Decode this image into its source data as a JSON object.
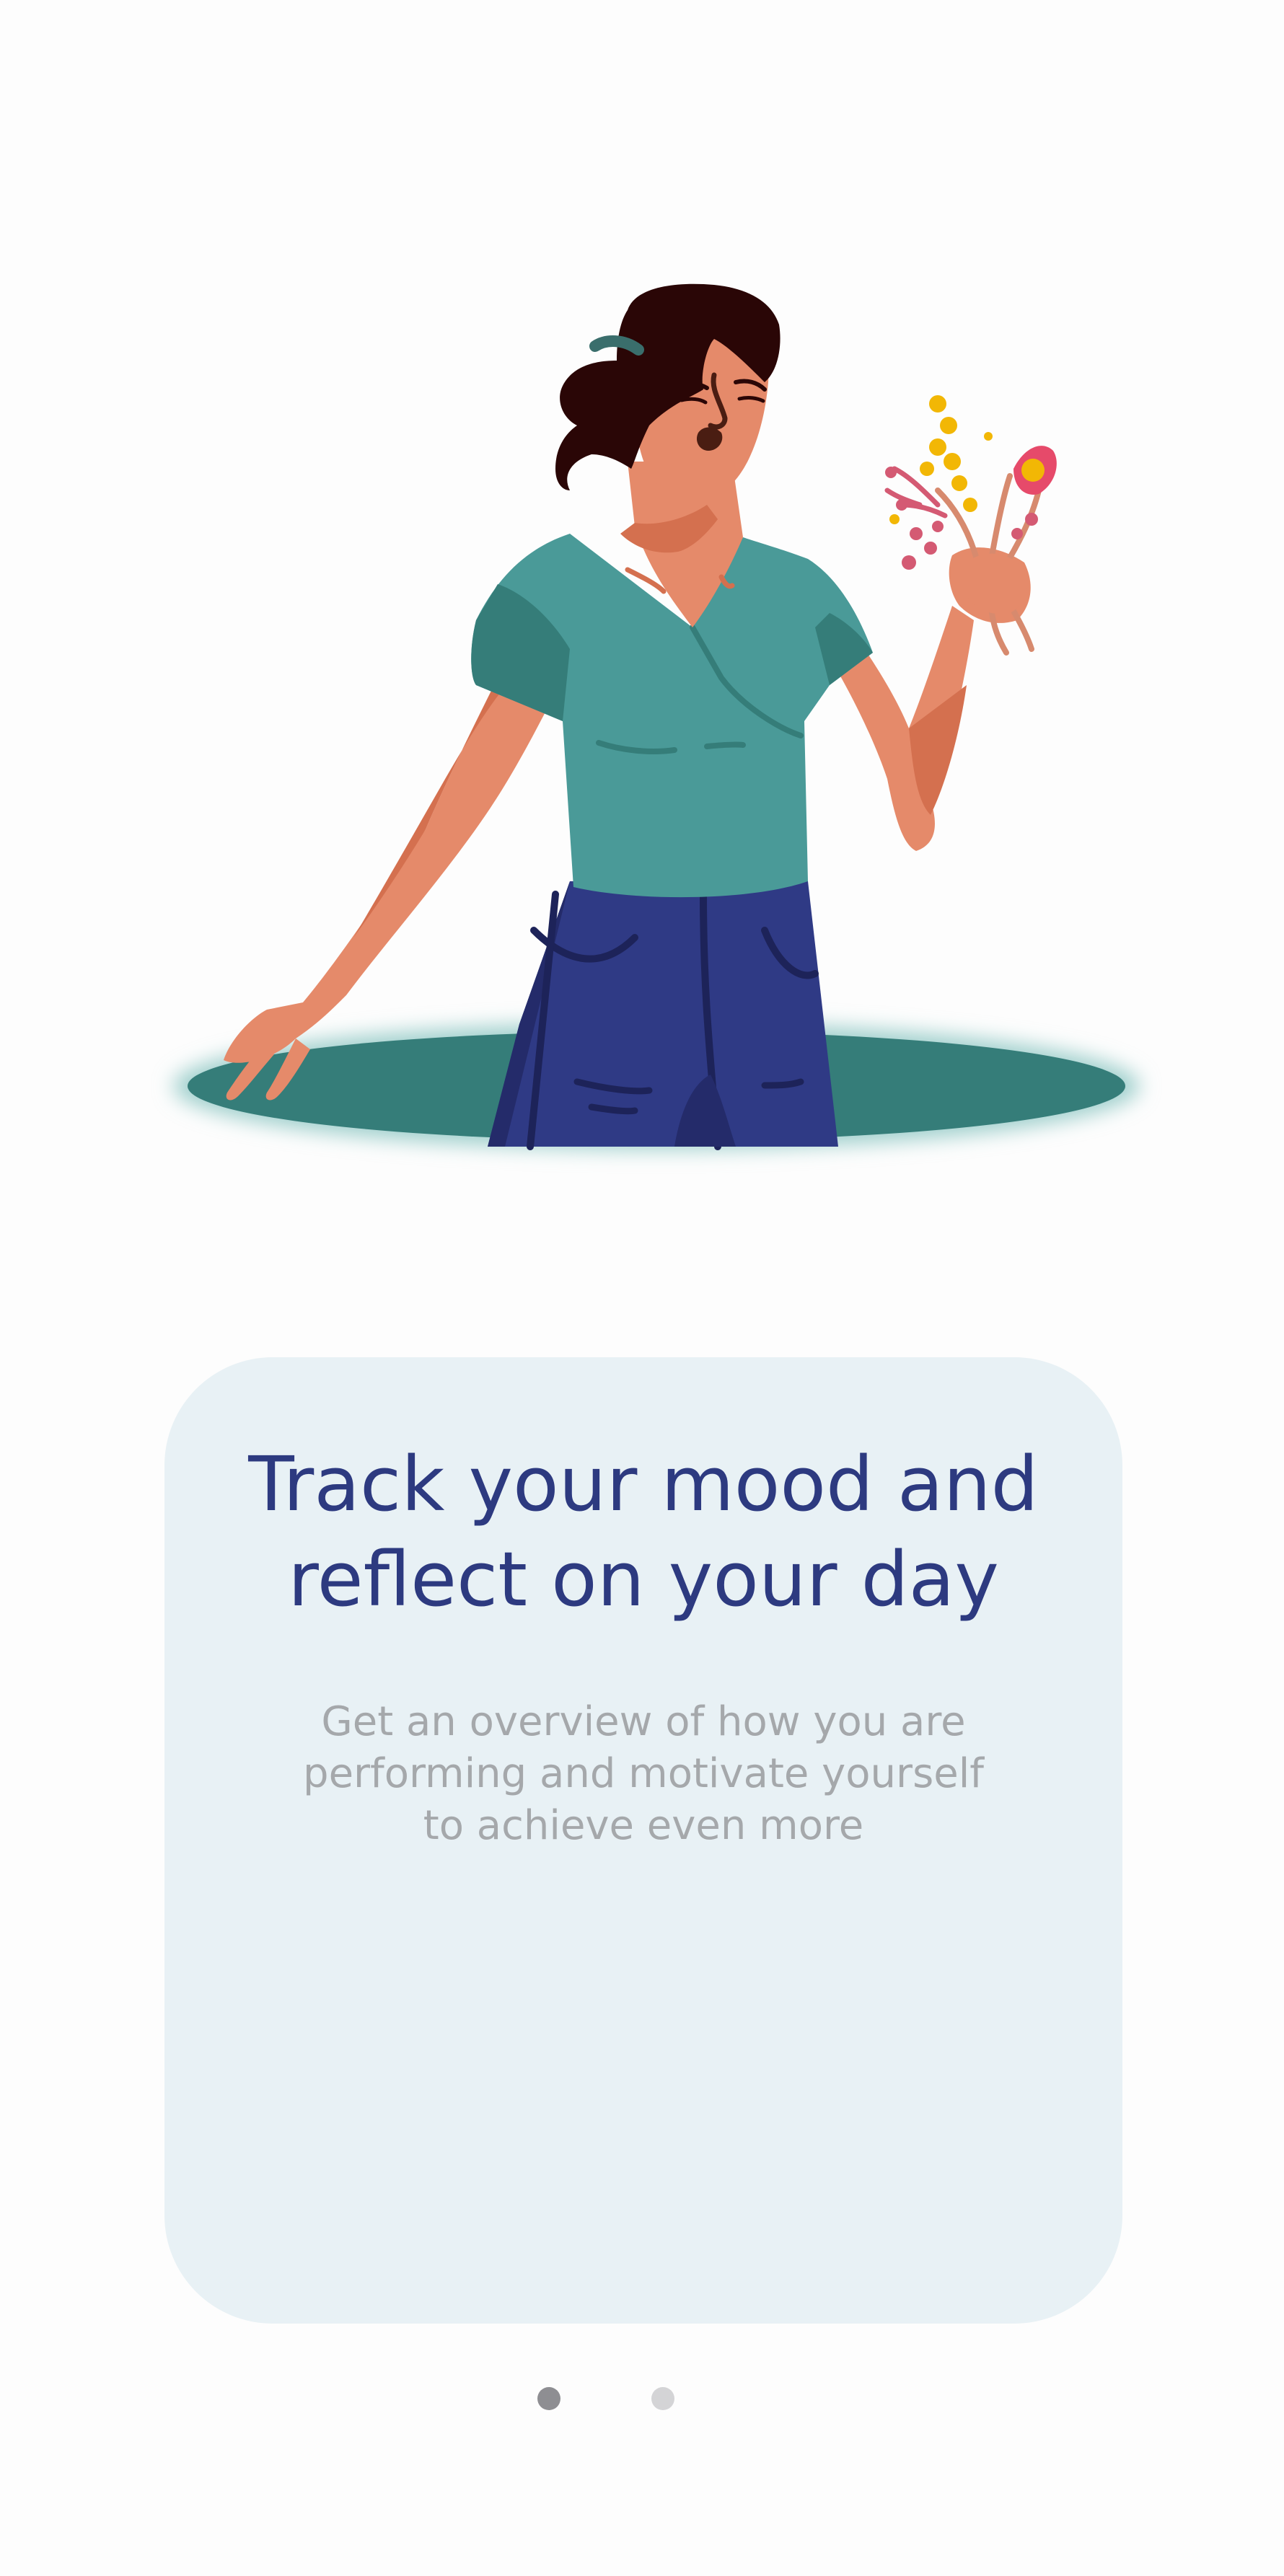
{
  "illustration": {
    "subject": "woman-holding-flowers-in-hole-illustration"
  },
  "card": {
    "title": "Track your mood and\nreflect on your day",
    "subtitle": "Get an overview of how you are\nperforming and motivate yourself\nto achieve even more"
  },
  "pager": {
    "total_pages": 2,
    "active_page": 1
  },
  "colors": {
    "background": "#fdfdfd",
    "card": "#e8f1f5",
    "title": "#2d3a80",
    "subtitle": "#a5a8ab",
    "dot_active": "#8e8e92",
    "dot_inactive": "#d4d4d6",
    "shirt": "#4a9a98",
    "jeans": "#2f3a85",
    "hole": "#357d79",
    "skin": "#e58a6a",
    "hair": "#2a0606"
  }
}
